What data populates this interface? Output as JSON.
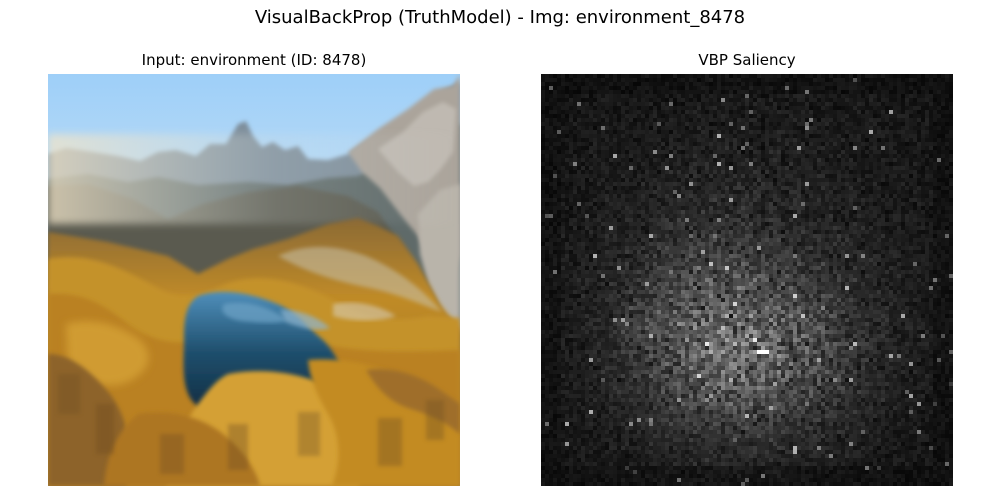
{
  "figure": {
    "suptitle": "VisualBackProp (TruthModel) - Img: environment_8478"
  },
  "panels": {
    "input": {
      "title": "Input: environment (ID: 8478)"
    },
    "saliency": {
      "title": "VBP Saliency"
    }
  },
  "colors": {
    "sky_top": "#a9d3f6",
    "sky_horizon": "#e5eef3",
    "mountain_blue": "#6f8497",
    "mountain_shadow": "#4c5559",
    "cliff": "#a7a39d",
    "forest_gold": "#c9911f",
    "forest_orange": "#b6791b",
    "forest_shadow": "#6f5228",
    "lake_blue": "#1f4f6d",
    "lake_dark": "#10293d",
    "saliency_bg": "#050505",
    "saliency_high": "#ffffff"
  }
}
